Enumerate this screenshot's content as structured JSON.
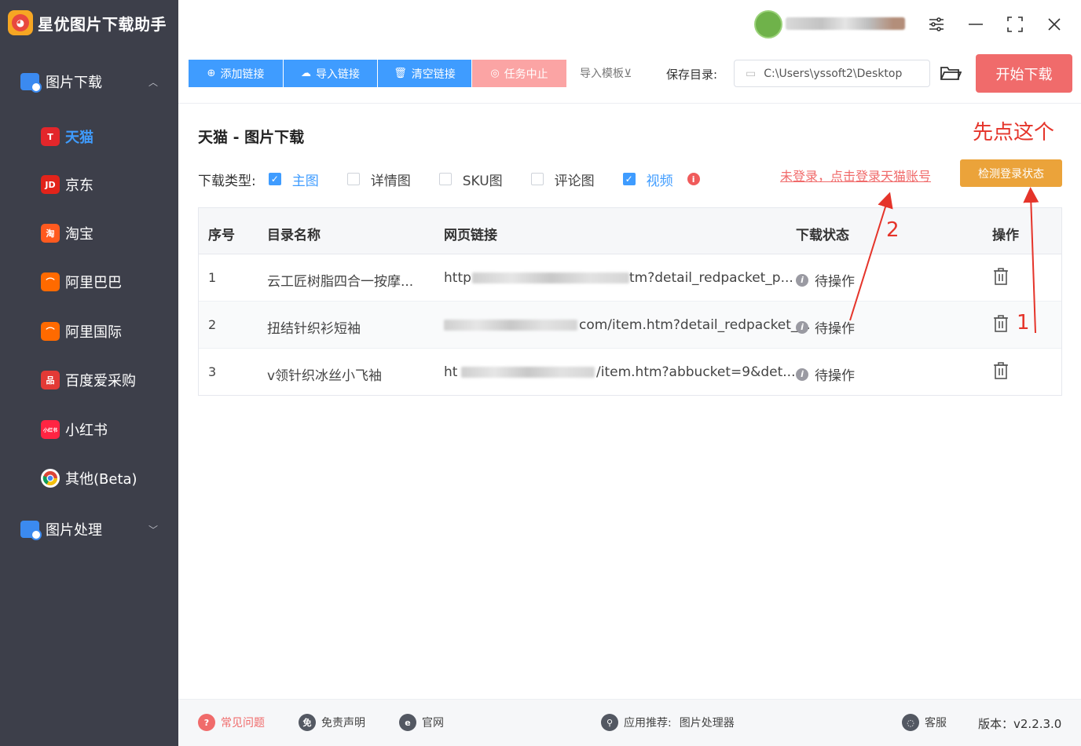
{
  "app": {
    "name": "星优图片下载助手"
  },
  "sidebar": {
    "group1": {
      "label": "图片下载"
    },
    "items": [
      {
        "label": "天猫",
        "icon": "tmall-icon",
        "badge": "T",
        "color": "#e3262b"
      },
      {
        "label": "京东",
        "icon": "jd-icon",
        "badge": "JD",
        "color": "#e2231a"
      },
      {
        "label": "淘宝",
        "icon": "taobao-icon",
        "badge": "淘",
        "color": "#ff5a1f"
      },
      {
        "label": "阿里巴巴",
        "icon": "alibaba-icon",
        "badge": "⌒",
        "color": "#ff6a00"
      },
      {
        "label": "阿里国际",
        "icon": "alibaba-intl-icon",
        "badge": "⌒",
        "color": "#ff6a00"
      },
      {
        "label": "百度爱采购",
        "icon": "baidu-icon",
        "badge": "品",
        "color": "#e33a36"
      },
      {
        "label": "小红书",
        "icon": "xiaohongshu-icon",
        "badge": "小红书",
        "color": "#ff2442"
      },
      {
        "label": "其他(Beta)",
        "icon": "chrome-icon",
        "badge": "",
        "color": "#ffffff"
      }
    ],
    "group2": {
      "label": "图片处理"
    }
  },
  "toolbar": {
    "add_link": "添加链接",
    "import_link": "导入链接",
    "clear_link": "清空链接",
    "stop_task": "任务中止",
    "import_template": "导入模板⊻",
    "save_dir_label": "保存目录:",
    "save_dir_value": "C:\\Users\\yssoft2\\Desktop",
    "start_download": "开始下载"
  },
  "main": {
    "title": "天猫 - 图片下载",
    "hint_first": "先点这个",
    "download_type_label": "下载类型:",
    "types": [
      {
        "label": "主图",
        "checked": true
      },
      {
        "label": "详情图",
        "checked": false
      },
      {
        "label": "SKU图",
        "checked": false
      },
      {
        "label": "评论图",
        "checked": false
      },
      {
        "label": "视频",
        "checked": true
      }
    ],
    "login_link": "未登录，点击登录天猫账号",
    "check_login_btn": "检测登录状态",
    "annotation_1": "1",
    "annotation_2": "2"
  },
  "table": {
    "headers": [
      "序号",
      "目录名称",
      "网页链接",
      "下载状态",
      "操作"
    ],
    "rows": [
      {
        "idx": "1",
        "name": "云工匠树脂四合一按摩...",
        "url_visible": "tm?detail_redpacket_p...",
        "url_prefix": "http",
        "status": "待操作"
      },
      {
        "idx": "2",
        "name": "扭结针织衫短袖",
        "url_visible": "com/item.htm?detail_redpacket_...",
        "url_prefix": "",
        "status": "待操作"
      },
      {
        "idx": "3",
        "name": "v领针织冰丝小飞袖",
        "url_visible": "/item.htm?abbucket=9&det...",
        "url_prefix": "ht",
        "status": "待操作"
      }
    ]
  },
  "footer": {
    "faq": "常见问题",
    "disclaimer": "免责声明",
    "website": "官网",
    "recommend_label": "应用推荐:",
    "recommend_app": "图片处理器",
    "service": "客服",
    "version": "版本：v2.2.3.0"
  },
  "colors": {
    "sidebar_bg": "#3d3f4a",
    "primary": "#3f9cff",
    "danger": "#f06b6b",
    "warning": "#eba33a",
    "annotation": "#e5342a"
  }
}
